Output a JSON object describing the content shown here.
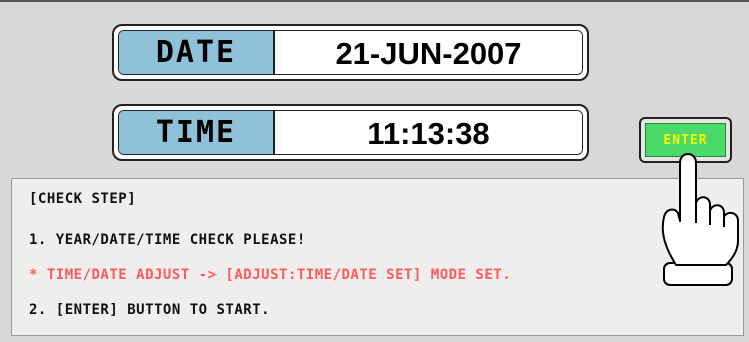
{
  "date": {
    "label": "DATE",
    "value": "21-JUN-2007"
  },
  "time": {
    "label": "TIME",
    "value": "11:13:38"
  },
  "enter_button": {
    "label": "ENTER"
  },
  "check_steps": {
    "title": "[CHECK STEP]",
    "step1": "1. YEAR/DATE/TIME CHECK PLEASE!",
    "note": "* TIME/DATE ADJUST -> [ADJUST:TIME/DATE SET] MODE SET.",
    "step2": "2. [ENTER] BUTTON TO START."
  },
  "colors": {
    "label_bg": "#8fc1d8",
    "enter_bg": "#4bd96a",
    "enter_text": "#f5f500",
    "note_text": "#ff5a5a"
  },
  "icons": {
    "pointer": "pointing-hand-icon"
  }
}
